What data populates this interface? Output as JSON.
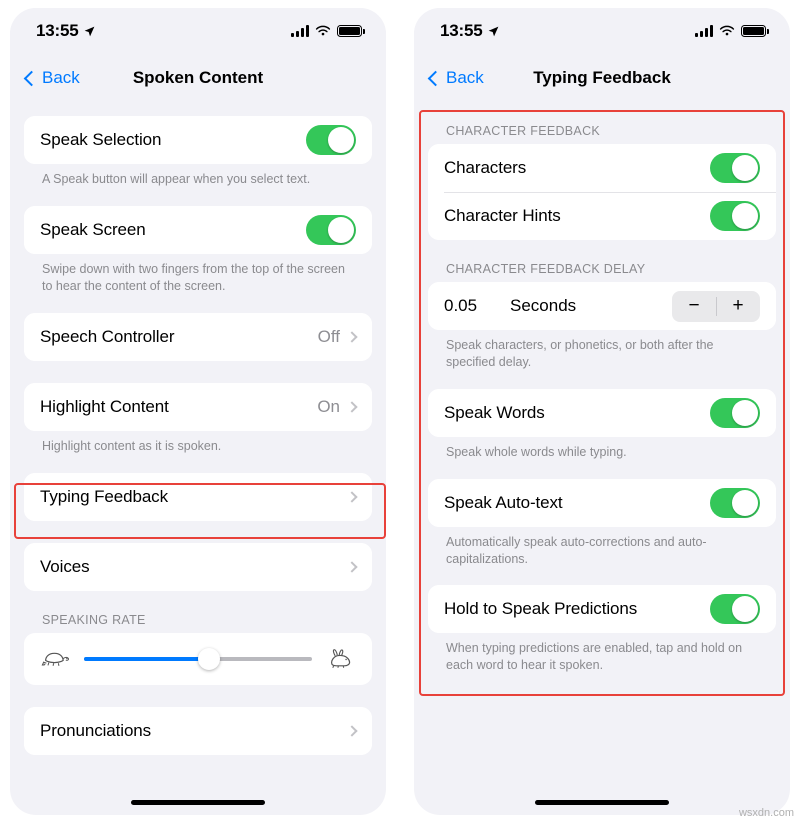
{
  "left_phone": {
    "status": {
      "time": "13:55",
      "location_icon": "location-arrow-icon",
      "signal_icon": "cellular-bars-icon",
      "wifi_icon": "wifi-icon",
      "battery_icon": "battery-full-icon"
    },
    "nav": {
      "back_label": "Back",
      "title": "Spoken Content"
    },
    "rows": [
      {
        "label": "Speak Selection",
        "type": "toggle",
        "value": "on",
        "footnote": "A Speak button will appear when you select text."
      },
      {
        "label": "Speak Screen",
        "type": "toggle",
        "value": "on",
        "footnote": "Swipe down with two fingers from the top of the screen to hear the content of the screen."
      },
      {
        "label": "Speech Controller",
        "type": "disclosure",
        "value": "Off",
        "footnote": ""
      },
      {
        "label": "Highlight Content",
        "type": "disclosure",
        "value": "On",
        "footnote": "Highlight content as it is spoken."
      },
      {
        "label": "Typing Feedback",
        "type": "disclosure",
        "value": "",
        "footnote": ""
      },
      {
        "label": "Voices",
        "type": "disclosure",
        "value": "",
        "footnote": ""
      }
    ],
    "speaking_rate": {
      "header": "SPEAKING RATE",
      "slow_icon": "tortoise-icon",
      "fast_icon": "hare-icon",
      "value_percent": 55
    },
    "pronunciations": {
      "label": "Pronunciations"
    }
  },
  "right_phone": {
    "status": {
      "time": "13:55",
      "location_icon": "location-arrow-icon",
      "signal_icon": "cellular-bars-icon",
      "wifi_icon": "wifi-icon",
      "battery_icon": "battery-full-icon"
    },
    "nav": {
      "back_label": "Back",
      "title": "Typing Feedback"
    },
    "character_feedback": {
      "header": "CHARACTER FEEDBACK",
      "rows": [
        {
          "label": "Characters",
          "value": "on"
        },
        {
          "label": "Character Hints",
          "value": "on"
        }
      ]
    },
    "character_delay": {
      "header": "CHARACTER FEEDBACK DELAY",
      "value": "0.05",
      "unit": "Seconds",
      "minus_label": "−",
      "plus_label": "+",
      "footnote": "Speak characters, or phonetics, or both after the specified delay."
    },
    "items": [
      {
        "label": "Speak Words",
        "value": "on",
        "footnote": "Speak whole words while typing."
      },
      {
        "label": "Speak Auto-text",
        "value": "on",
        "footnote": "Automatically speak auto-corrections and auto-capitalizations."
      },
      {
        "label": "Hold to Speak Predictions",
        "value": "on",
        "footnote": "When typing predictions are enabled, tap and hold on each word to hear it spoken."
      }
    ]
  },
  "watermark": "wsxdn.com",
  "colors": {
    "toggle_on": "#34c759",
    "accent_blue": "#007aff",
    "highlight_red": "#e8413a",
    "background": "#f2f2f7"
  }
}
